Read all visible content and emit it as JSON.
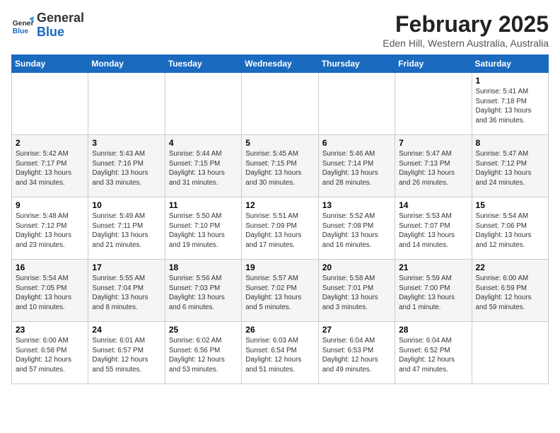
{
  "header": {
    "logo_line1": "General",
    "logo_line2": "Blue",
    "title": "February 2025",
    "subtitle": "Eden Hill, Western Australia, Australia"
  },
  "days_of_week": [
    "Sunday",
    "Monday",
    "Tuesday",
    "Wednesday",
    "Thursday",
    "Friday",
    "Saturday"
  ],
  "weeks": [
    [
      {
        "day": "",
        "info": ""
      },
      {
        "day": "",
        "info": ""
      },
      {
        "day": "",
        "info": ""
      },
      {
        "day": "",
        "info": ""
      },
      {
        "day": "",
        "info": ""
      },
      {
        "day": "",
        "info": ""
      },
      {
        "day": "1",
        "info": "Sunrise: 5:41 AM\nSunset: 7:18 PM\nDaylight: 13 hours\nand 36 minutes."
      }
    ],
    [
      {
        "day": "2",
        "info": "Sunrise: 5:42 AM\nSunset: 7:17 PM\nDaylight: 13 hours\nand 34 minutes."
      },
      {
        "day": "3",
        "info": "Sunrise: 5:43 AM\nSunset: 7:16 PM\nDaylight: 13 hours\nand 33 minutes."
      },
      {
        "day": "4",
        "info": "Sunrise: 5:44 AM\nSunset: 7:15 PM\nDaylight: 13 hours\nand 31 minutes."
      },
      {
        "day": "5",
        "info": "Sunrise: 5:45 AM\nSunset: 7:15 PM\nDaylight: 13 hours\nand 30 minutes."
      },
      {
        "day": "6",
        "info": "Sunrise: 5:46 AM\nSunset: 7:14 PM\nDaylight: 13 hours\nand 28 minutes."
      },
      {
        "day": "7",
        "info": "Sunrise: 5:47 AM\nSunset: 7:13 PM\nDaylight: 13 hours\nand 26 minutes."
      },
      {
        "day": "8",
        "info": "Sunrise: 5:47 AM\nSunset: 7:12 PM\nDaylight: 13 hours\nand 24 minutes."
      }
    ],
    [
      {
        "day": "9",
        "info": "Sunrise: 5:48 AM\nSunset: 7:12 PM\nDaylight: 13 hours\nand 23 minutes."
      },
      {
        "day": "10",
        "info": "Sunrise: 5:49 AM\nSunset: 7:11 PM\nDaylight: 13 hours\nand 21 minutes."
      },
      {
        "day": "11",
        "info": "Sunrise: 5:50 AM\nSunset: 7:10 PM\nDaylight: 13 hours\nand 19 minutes."
      },
      {
        "day": "12",
        "info": "Sunrise: 5:51 AM\nSunset: 7:09 PM\nDaylight: 13 hours\nand 17 minutes."
      },
      {
        "day": "13",
        "info": "Sunrise: 5:52 AM\nSunset: 7:08 PM\nDaylight: 13 hours\nand 16 minutes."
      },
      {
        "day": "14",
        "info": "Sunrise: 5:53 AM\nSunset: 7:07 PM\nDaylight: 13 hours\nand 14 minutes."
      },
      {
        "day": "15",
        "info": "Sunrise: 5:54 AM\nSunset: 7:06 PM\nDaylight: 13 hours\nand 12 minutes."
      }
    ],
    [
      {
        "day": "16",
        "info": "Sunrise: 5:54 AM\nSunset: 7:05 PM\nDaylight: 13 hours\nand 10 minutes."
      },
      {
        "day": "17",
        "info": "Sunrise: 5:55 AM\nSunset: 7:04 PM\nDaylight: 13 hours\nand 8 minutes."
      },
      {
        "day": "18",
        "info": "Sunrise: 5:56 AM\nSunset: 7:03 PM\nDaylight: 13 hours\nand 6 minutes."
      },
      {
        "day": "19",
        "info": "Sunrise: 5:57 AM\nSunset: 7:02 PM\nDaylight: 13 hours\nand 5 minutes."
      },
      {
        "day": "20",
        "info": "Sunrise: 5:58 AM\nSunset: 7:01 PM\nDaylight: 13 hours\nand 3 minutes."
      },
      {
        "day": "21",
        "info": "Sunrise: 5:59 AM\nSunset: 7:00 PM\nDaylight: 13 hours\nand 1 minute."
      },
      {
        "day": "22",
        "info": "Sunrise: 6:00 AM\nSunset: 6:59 PM\nDaylight: 12 hours\nand 59 minutes."
      }
    ],
    [
      {
        "day": "23",
        "info": "Sunrise: 6:00 AM\nSunset: 6:58 PM\nDaylight: 12 hours\nand 57 minutes."
      },
      {
        "day": "24",
        "info": "Sunrise: 6:01 AM\nSunset: 6:57 PM\nDaylight: 12 hours\nand 55 minutes."
      },
      {
        "day": "25",
        "info": "Sunrise: 6:02 AM\nSunset: 6:56 PM\nDaylight: 12 hours\nand 53 minutes."
      },
      {
        "day": "26",
        "info": "Sunrise: 6:03 AM\nSunset: 6:54 PM\nDaylight: 12 hours\nand 51 minutes."
      },
      {
        "day": "27",
        "info": "Sunrise: 6:04 AM\nSunset: 6:53 PM\nDaylight: 12 hours\nand 49 minutes."
      },
      {
        "day": "28",
        "info": "Sunrise: 6:04 AM\nSunset: 6:52 PM\nDaylight: 12 hours\nand 47 minutes."
      },
      {
        "day": "",
        "info": ""
      }
    ]
  ]
}
